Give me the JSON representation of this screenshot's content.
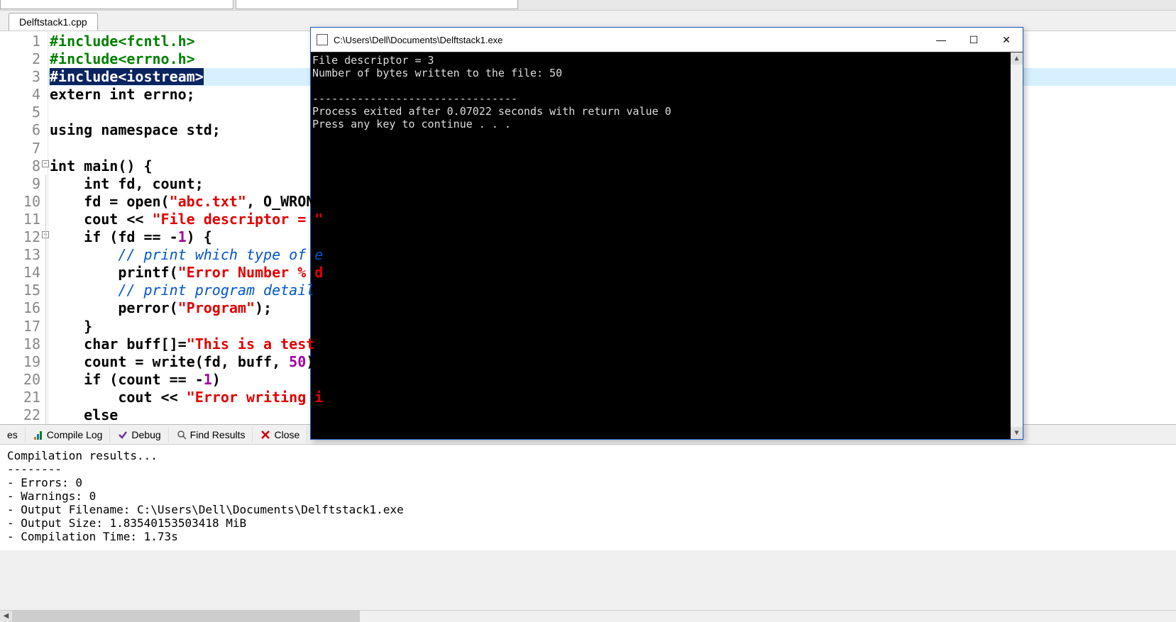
{
  "tab": {
    "filename": "Delftstack1.cpp"
  },
  "code": {
    "highlighted_line_index": 2,
    "lines": [
      {
        "n": 1,
        "seg": [
          {
            "c": "pp",
            "t": "#include<fcntl.h>"
          }
        ]
      },
      {
        "n": 2,
        "seg": [
          {
            "c": "pp",
            "t": "#include<errno.h>"
          }
        ]
      },
      {
        "n": 3,
        "seg": [
          {
            "c": "pp-sel",
            "t": "#include<iostream>"
          }
        ]
      },
      {
        "n": 4,
        "seg": [
          {
            "c": "kw",
            "t": "extern int "
          },
          {
            "c": "norm",
            "t": "errno;"
          }
        ]
      },
      {
        "n": 5,
        "seg": []
      },
      {
        "n": 6,
        "seg": [
          {
            "c": "kw",
            "t": "using namespace "
          },
          {
            "c": "norm",
            "t": "std;"
          }
        ]
      },
      {
        "n": 7,
        "seg": []
      },
      {
        "n": 8,
        "fold": true,
        "seg": [
          {
            "c": "kw",
            "t": "int "
          },
          {
            "c": "norm",
            "t": "main() {"
          }
        ]
      },
      {
        "n": 9,
        "seg": [
          {
            "c": "norm",
            "t": "    "
          },
          {
            "c": "kw",
            "t": "int "
          },
          {
            "c": "norm",
            "t": "fd, count;"
          }
        ]
      },
      {
        "n": 10,
        "seg": [
          {
            "c": "norm",
            "t": "    fd = open("
          },
          {
            "c": "str",
            "t": "\"abc.txt\""
          },
          {
            "c": "norm",
            "t": ", O_WRONL"
          }
        ]
      },
      {
        "n": 11,
        "seg": [
          {
            "c": "norm",
            "t": "    cout << "
          },
          {
            "c": "str",
            "t": "\"File descriptor = \""
          }
        ]
      },
      {
        "n": 12,
        "fold": true,
        "seg": [
          {
            "c": "norm",
            "t": "    "
          },
          {
            "c": "kw",
            "t": "if "
          },
          {
            "c": "norm",
            "t": "(fd == -"
          },
          {
            "c": "num",
            "t": "1"
          },
          {
            "c": "norm",
            "t": ") {"
          }
        ]
      },
      {
        "n": 13,
        "seg": [
          {
            "c": "norm",
            "t": "        "
          },
          {
            "c": "cmt",
            "t": "// print which type of e"
          }
        ]
      },
      {
        "n": 14,
        "seg": [
          {
            "c": "norm",
            "t": "        printf("
          },
          {
            "c": "str",
            "t": "\"Error Number % d"
          }
        ]
      },
      {
        "n": 15,
        "seg": [
          {
            "c": "norm",
            "t": "        "
          },
          {
            "c": "cmt",
            "t": "// print program detail"
          }
        ]
      },
      {
        "n": 16,
        "seg": [
          {
            "c": "norm",
            "t": "        perror("
          },
          {
            "c": "str",
            "t": "\"Program\""
          },
          {
            "c": "norm",
            "t": ");"
          }
        ]
      },
      {
        "n": 17,
        "seg": [
          {
            "c": "norm",
            "t": "    }"
          }
        ]
      },
      {
        "n": 18,
        "seg": [
          {
            "c": "norm",
            "t": "    "
          },
          {
            "c": "kw",
            "t": "char "
          },
          {
            "c": "norm",
            "t": "buff[]="
          },
          {
            "c": "str",
            "t": "\"This is a test"
          }
        ]
      },
      {
        "n": 19,
        "seg": [
          {
            "c": "norm",
            "t": "    count = write(fd, buff, "
          },
          {
            "c": "num",
            "t": "50"
          },
          {
            "c": "norm",
            "t": ");"
          }
        ]
      },
      {
        "n": 20,
        "seg": [
          {
            "c": "norm",
            "t": "    "
          },
          {
            "c": "kw",
            "t": "if "
          },
          {
            "c": "norm",
            "t": "(count == -"
          },
          {
            "c": "num",
            "t": "1"
          },
          {
            "c": "norm",
            "t": ")"
          }
        ]
      },
      {
        "n": 21,
        "seg": [
          {
            "c": "norm",
            "t": "        cout << "
          },
          {
            "c": "str",
            "t": "\"Error writing i"
          }
        ]
      },
      {
        "n": 22,
        "seg": [
          {
            "c": "norm",
            "t": "    "
          },
          {
            "c": "kw",
            "t": "else"
          }
        ]
      }
    ]
  },
  "bottom_tabs": {
    "resources_partial": "es",
    "compile_log": "Compile Log",
    "debug": "Debug",
    "find_results": "Find Results",
    "close": "Close"
  },
  "output": {
    "header": "Compilation results...",
    "sep": "--------",
    "errors": "- Errors: 0",
    "warnings": "- Warnings: 0",
    "filename": "- Output Filename: C:\\Users\\Dell\\Documents\\Delftstack1.exe",
    "size": "- Output Size: 1.83540153503418 MiB",
    "time": "- Compilation Time: 1.73s"
  },
  "console": {
    "title": "C:\\Users\\Dell\\Documents\\Delftstack1.exe",
    "line1": "File descriptor = 3",
    "line2": "Number of bytes written to the file: 50",
    "blank": "",
    "sep": "--------------------------------",
    "exit": "Process exited after 0.07022 seconds with return value 0",
    "prompt": "Press any key to continue . . ."
  },
  "win_controls": {
    "min": "—",
    "max": "☐",
    "close": "✕"
  },
  "scroll": {
    "up": "▲",
    "down": "▼",
    "left": "◀"
  }
}
